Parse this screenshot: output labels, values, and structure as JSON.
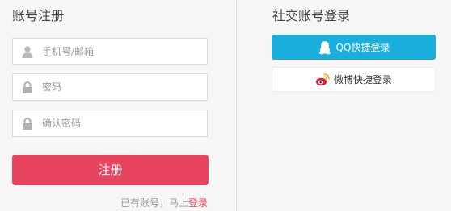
{
  "register": {
    "title": "账号注册",
    "phone_placeholder": "手机号/邮箱",
    "password_placeholder": "密码",
    "confirm_placeholder": "确认密码",
    "submit_label": "注册",
    "hint_text": "已有账号，马上",
    "login_link": "登录"
  },
  "social": {
    "title": "社交账号登录",
    "qq_label": "QQ快捷登录",
    "weibo_label": "微博快捷登录"
  },
  "colors": {
    "accent": "#e8435f",
    "qq": "#1aaedd",
    "weibo": "#e6162d"
  },
  "icons": {
    "phone": "user-icon",
    "password": "lock-icon",
    "confirm": "lock-icon",
    "qq": "qq-penguin-icon",
    "weibo": "weibo-icon"
  }
}
